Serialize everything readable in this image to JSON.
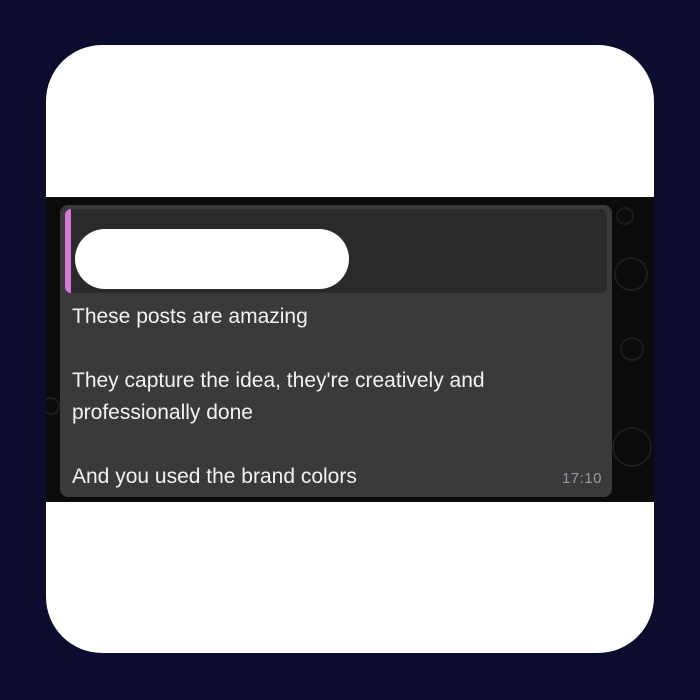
{
  "message": {
    "lines": [
      "These posts are amazing",
      "They capture the idea, they're creatively and",
      "professionally done",
      "And you used the brand colors"
    ],
    "time": "17:10"
  },
  "colors": {
    "background": "#0c0c2e",
    "bubble": "#3a3a3c",
    "quote_accent": "#d77bd6"
  }
}
